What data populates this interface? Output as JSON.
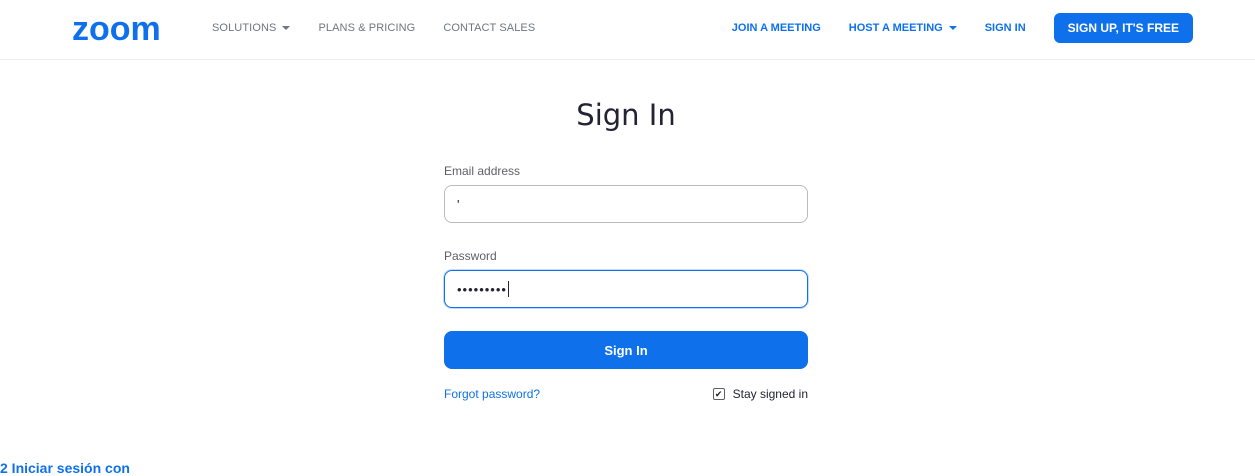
{
  "header": {
    "logo_text": "zoom",
    "nav_left": [
      "SOLUTIONS",
      "PLANS & PRICING",
      "CONTACT SALES"
    ],
    "nav_right": [
      "JOIN A MEETING",
      "HOST A MEETING",
      "SIGN IN"
    ],
    "signup_label": "SIGN UP, IT'S FREE"
  },
  "form": {
    "title": "Sign In",
    "email_label": "Email address",
    "email_value": "'",
    "password_label": "Password",
    "password_value": "•••••••••",
    "submit_label": "Sign In",
    "forgot_label": "Forgot password?",
    "stay_label": "Stay signed in",
    "stay_checked": true
  },
  "footer": {
    "text": "2 Iniciar sesión con"
  },
  "colors": {
    "accent": "#0e71eb"
  }
}
